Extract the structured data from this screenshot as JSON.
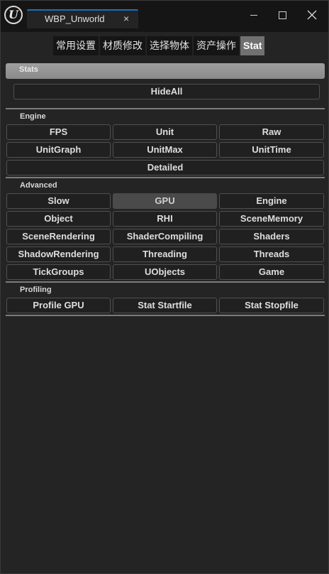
{
  "window": {
    "tab_title": "WBP_Unworld",
    "close_tab_glyph": "×"
  },
  "segments": [
    {
      "label": "常用设置",
      "active": false
    },
    {
      "label": "材质修改",
      "active": false
    },
    {
      "label": "选择物体",
      "active": false
    },
    {
      "label": "资产操作",
      "active": false
    },
    {
      "label": "Stat",
      "active": true
    }
  ],
  "stats_header": "Stats",
  "hideall_label": "HideAll",
  "engine": {
    "title": "Engine",
    "buttons": [
      "FPS",
      "Unit",
      "Raw",
      "UnitGraph",
      "UnitMax",
      "UnitTime",
      "Detailed"
    ]
  },
  "advanced": {
    "title": "Advanced",
    "buttons": [
      "Slow",
      "GPU",
      "Engine",
      "Object",
      "RHI",
      "SceneMemory",
      "SceneRendering",
      "ShaderCompiling",
      "Shaders",
      "ShadowRendering",
      "Threading",
      "Threads",
      "TickGroups",
      "UObjects",
      "Game"
    ],
    "pressed": "GPU"
  },
  "profiling": {
    "title": "Profiling",
    "buttons": [
      "Profile GPU",
      "Stat Startfile",
      "Stat Stopfile"
    ]
  }
}
